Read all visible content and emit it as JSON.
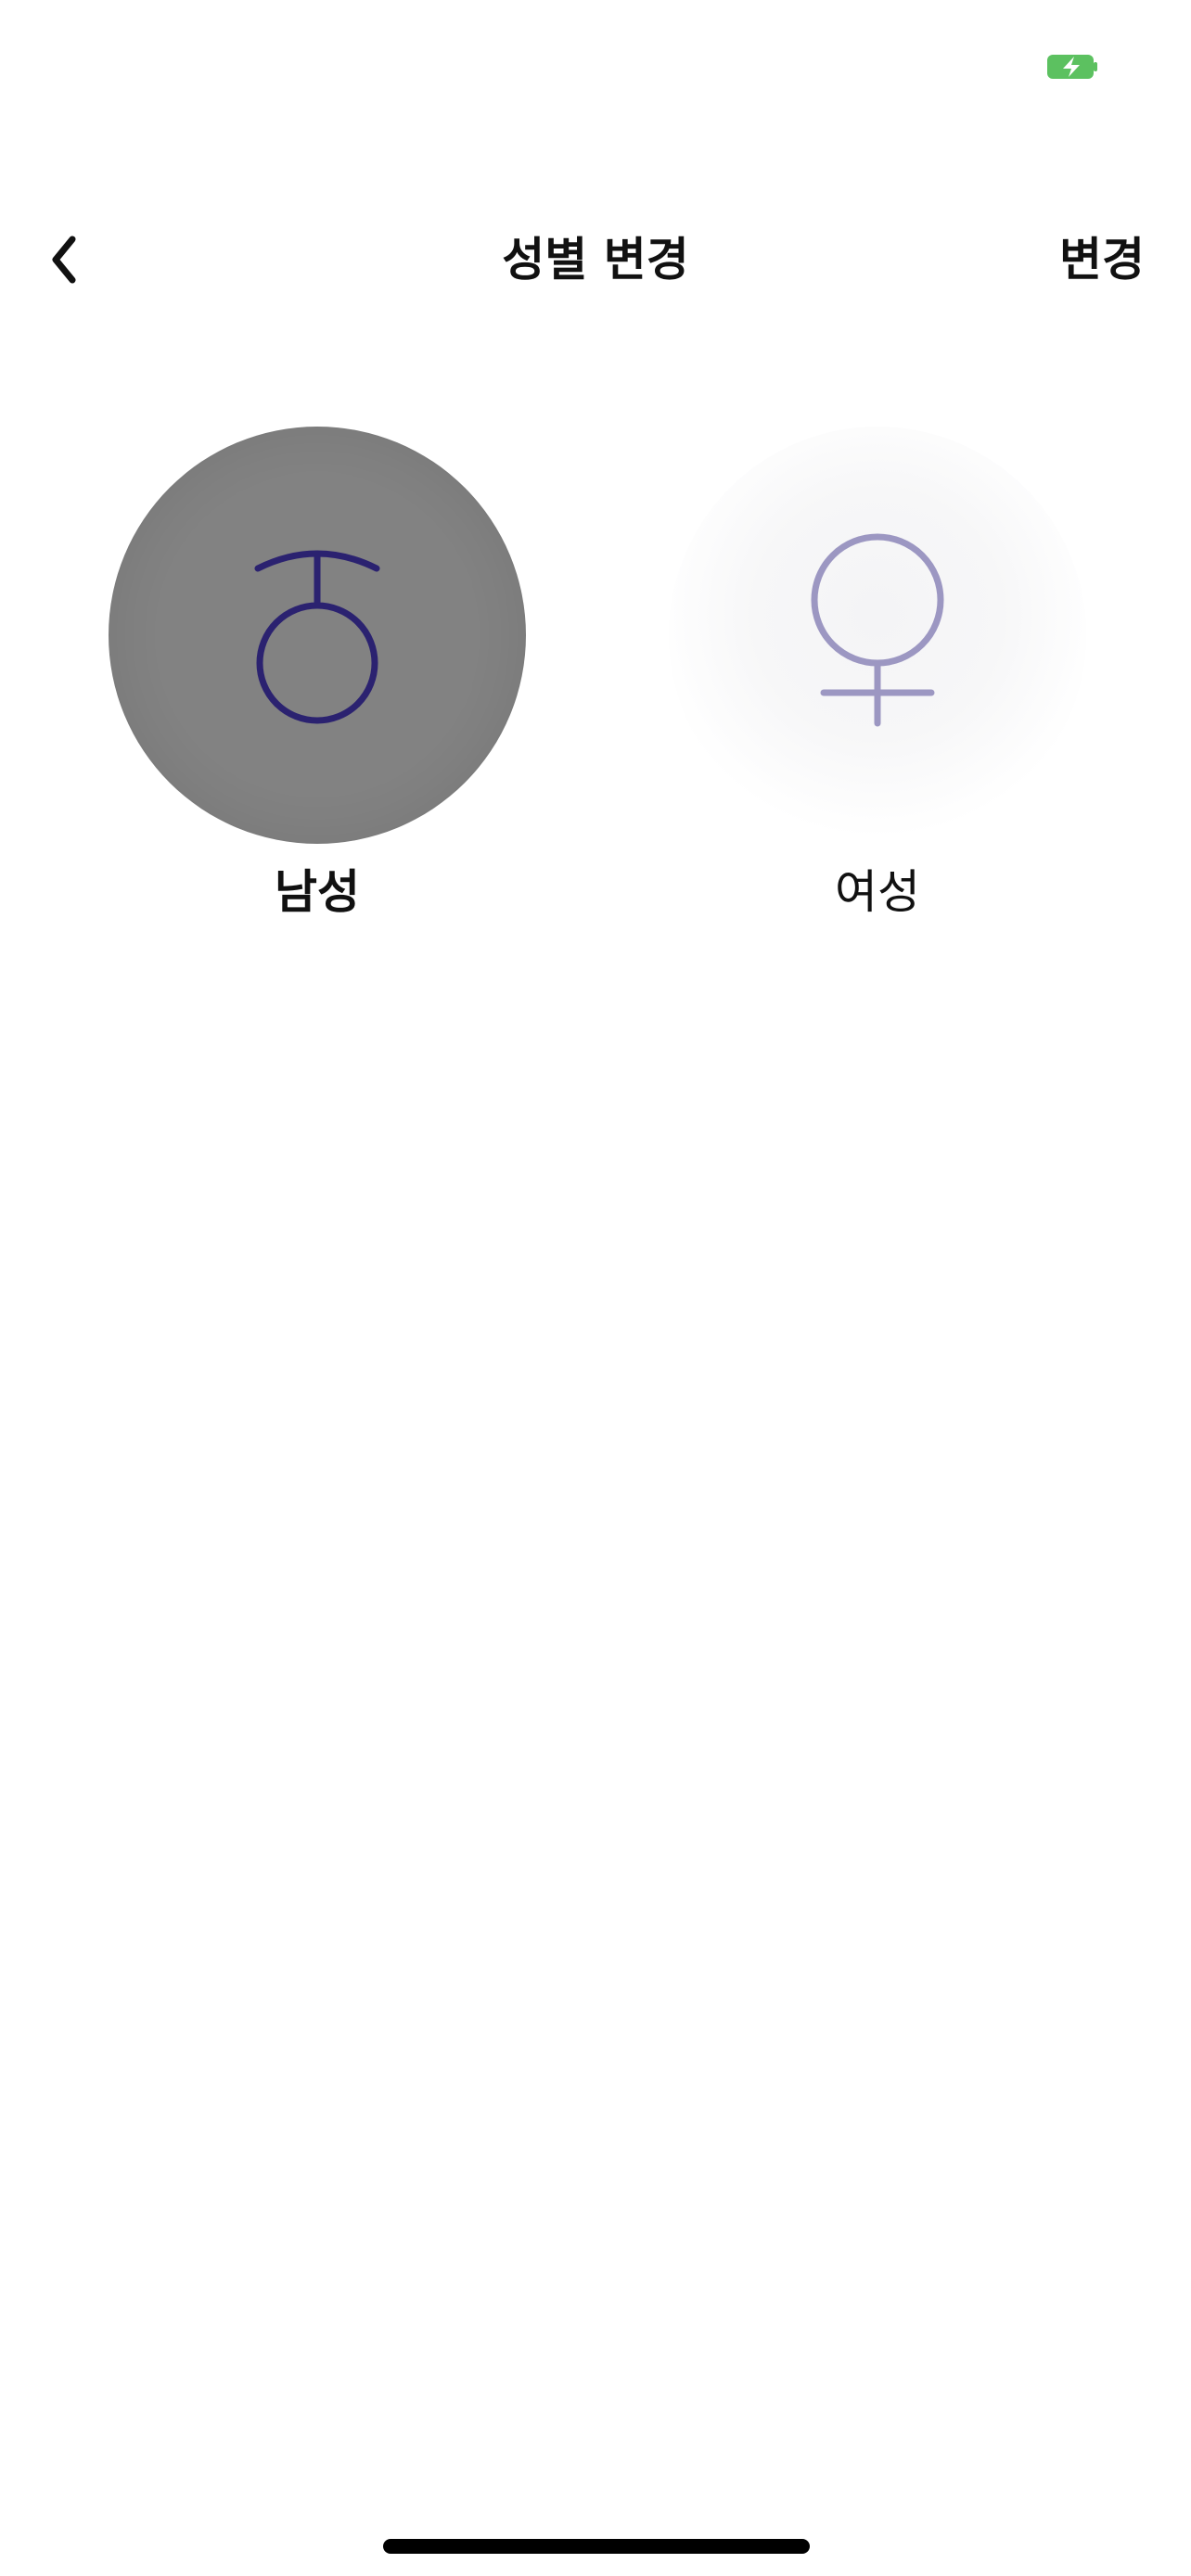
{
  "status_bar": {
    "battery_icon": "battery-charging-icon",
    "battery_color": "#5cc160"
  },
  "nav": {
    "back_icon": "chevron-left-icon",
    "title": "성별 변경",
    "action_label": "변경"
  },
  "options": [
    {
      "label": "남성",
      "icon": "male-symbol-icon",
      "selected": true
    },
    {
      "label": "여성",
      "icon": "female-symbol-icon",
      "selected": false
    }
  ],
  "colors": {
    "selected_circle": "#828282",
    "symbol_selected": "#2b2270",
    "symbol_unselected": "#9c97c2"
  }
}
